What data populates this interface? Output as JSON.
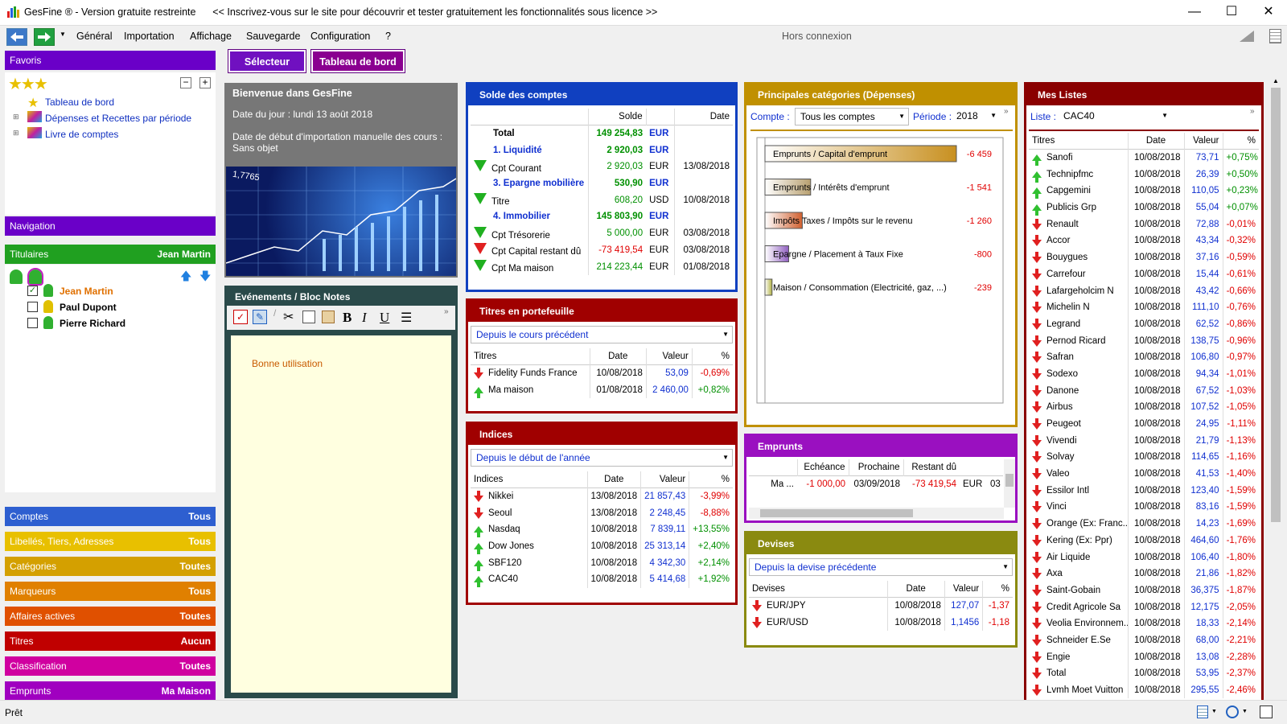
{
  "titlebar": {
    "title": "GesFine ® - Version gratuite restreinte      << Inscrivez-vous sur le site pour découvrir et tester gratuitement les fonctionnalités sous licence >>",
    "minimize": "—",
    "maximize": "☐",
    "close": "✕"
  },
  "menu": {
    "items": [
      "Général",
      "Importation",
      "Affichage",
      "Sauvegarde",
      "Configuration",
      "?"
    ],
    "status": "Hors connexion"
  },
  "tabs": {
    "selector": "Sélecteur",
    "dashboard": "Tableau de bord"
  },
  "left": {
    "favoris": "Favoris",
    "favoris_items": [
      "Tableau de bord",
      "Dépenses et Recettes par période",
      "Livre de comptes"
    ],
    "navigation": "Navigation",
    "titulaires": "Titulaires",
    "titulaires_value": "Jean Martin",
    "people": [
      "Jean Martin",
      "Paul Dupont",
      "Pierre Richard"
    ],
    "sections": [
      {
        "label": "Comptes",
        "value": "Tous",
        "color": "#2e5fd0"
      },
      {
        "label": "Libellés, Tiers, Adresses",
        "value": "Tous",
        "color": "#e8c000"
      },
      {
        "label": "Catégories",
        "value": "Toutes",
        "color": "#d4a000"
      },
      {
        "label": "Marqueurs",
        "value": "Tous",
        "color": "#e08000"
      },
      {
        "label": "Affaires actives",
        "value": "Toutes",
        "color": "#e05000"
      },
      {
        "label": "Titres",
        "value": "Aucun",
        "color": "#c00000"
      },
      {
        "label": "Classification",
        "value": "Toutes",
        "color": "#d000a0"
      },
      {
        "label": "Emprunts",
        "value": "Ma Maison",
        "color": "#a000c0"
      }
    ]
  },
  "welcome": {
    "title": "Bienvenue dans GesFine",
    "date": "Date du jour : lundi 13 août 2018",
    "import": "Date de début d'importation manuelle des cours : Sans objet",
    "img_text": "1,7765"
  },
  "notes": {
    "title": "Evénements / Bloc Notes",
    "text": "Bonne utilisation"
  },
  "solde": {
    "title": "Solde des comptes",
    "headers": [
      "",
      "Solde",
      "",
      "Date"
    ],
    "rows": [
      {
        "label": "Total",
        "amount": "149 254,83",
        "cur": "EUR",
        "date": "",
        "kind": "total",
        "icon": ""
      },
      {
        "label": "1. Liquidité",
        "amount": "2 920,03",
        "cur": "EUR",
        "date": "",
        "kind": "group",
        "icon": ""
      },
      {
        "label": "Cpt Courant",
        "amount": "2 920,03",
        "cur": "EUR",
        "date": "13/08/2018",
        "kind": "item",
        "icon": "g"
      },
      {
        "label": "3. Epargne mobilière",
        "amount": "530,90",
        "cur": "EUR",
        "date": "",
        "kind": "group",
        "icon": ""
      },
      {
        "label": "Titre",
        "amount": "608,20",
        "cur": "USD",
        "date": "10/08/2018",
        "kind": "item",
        "icon": "g"
      },
      {
        "label": "4. Immobilier",
        "amount": "145 803,90",
        "cur": "EUR",
        "date": "",
        "kind": "group",
        "icon": ""
      },
      {
        "label": "Cpt Trésorerie",
        "amount": "5 000,00",
        "cur": "EUR",
        "date": "03/08/2018",
        "kind": "item",
        "icon": "g"
      },
      {
        "label": "Cpt Capital restant dû",
        "amount": "-73 419,54",
        "cur": "EUR",
        "date": "03/08/2018",
        "kind": "neg",
        "icon": "r"
      },
      {
        "label": "Cpt Ma maison",
        "amount": "214 223,44",
        "cur": "EUR",
        "date": "01/08/2018",
        "kind": "item",
        "icon": "g"
      }
    ]
  },
  "portefeuille": {
    "title": "Titres en portefeuille",
    "combo": "Depuis le cours précédent",
    "headers": [
      "Titres",
      "Date",
      "Valeur",
      "%"
    ],
    "rows": [
      {
        "name": "Fidelity Funds France",
        "date": "10/08/2018",
        "value": "53,09",
        "pct": "-0,69%",
        "dir": "dn"
      },
      {
        "name": "Ma maison",
        "date": "01/08/2018",
        "value": "2 460,00",
        "pct": "+0,82%",
        "dir": "up"
      }
    ]
  },
  "indices": {
    "title": "Indices",
    "combo": "Depuis le début de l'année",
    "headers": [
      "Indices",
      "Date",
      "Valeur",
      "%"
    ],
    "rows": [
      {
        "name": "Nikkei",
        "date": "13/08/2018",
        "value": "21 857,43",
        "pct": "-3,99%",
        "dir": "dn"
      },
      {
        "name": "Seoul",
        "date": "13/08/2018",
        "value": "2 248,45",
        "pct": "-8,88%",
        "dir": "dn"
      },
      {
        "name": "Nasdaq",
        "date": "10/08/2018",
        "value": "7 839,11",
        "pct": "+13,55%",
        "dir": "up"
      },
      {
        "name": "Dow Jones",
        "date": "10/08/2018",
        "value": "25 313,14",
        "pct": "+2,40%",
        "dir": "up"
      },
      {
        "name": "SBF120",
        "date": "10/08/2018",
        "value": "4 342,30",
        "pct": "+2,14%",
        "dir": "up"
      },
      {
        "name": "CAC40",
        "date": "10/08/2018",
        "value": "5 414,68",
        "pct": "+1,92%",
        "dir": "up"
      }
    ]
  },
  "categories": {
    "title": "Principales catégories (Dépenses)",
    "compte_label": "Compte :",
    "compte_value": "Tous les comptes",
    "periode_label": "Période :",
    "periode_value": "2018",
    "bars": [
      {
        "cat": "Emprunts",
        "sub": " / Capital d'emprunt",
        "value": "-6 459",
        "amount": 6459,
        "color": "#c89020"
      },
      {
        "cat": "Emprunts",
        "sub": " / Intérêts d'emprunt",
        "value": "-1 541",
        "amount": 1541,
        "color": "#b8a070"
      },
      {
        "cat": "Impôts",
        "sub": " Taxes / Impôts sur le revenu",
        "value": "-1 260",
        "amount": 1260,
        "color": "#d06030"
      },
      {
        "cat": "Epargne",
        "sub": " / Placement à Taux Fixe",
        "value": "-800",
        "amount": 800,
        "color": "#9060c0"
      },
      {
        "cat": "",
        "sub": "Maison / Consommation (Electricité, gaz, ...)",
        "value": "-239",
        "amount": 239,
        "color": "#b0b040"
      }
    ]
  },
  "emprunts": {
    "title": "Emprunts",
    "headers": [
      "",
      "Echéance",
      "Prochaine",
      "Restant dû",
      "",
      ""
    ],
    "row": [
      "Ma ...",
      "-1 000,00",
      "03/09/2018",
      "-73 419,54",
      "EUR",
      "03"
    ]
  },
  "devises": {
    "title": "Devises",
    "combo": "Depuis la devise précédente",
    "headers": [
      "Devises",
      "Date",
      "Valeur",
      "%"
    ],
    "rows": [
      {
        "name": "EUR/JPY",
        "date": "10/08/2018",
        "value": "127,07",
        "pct": "-1,37"
      },
      {
        "name": "EUR/USD",
        "date": "10/08/2018",
        "value": "1,1456",
        "pct": "-1,18"
      }
    ]
  },
  "listes": {
    "title": "Mes Listes",
    "liste_label": "Liste :",
    "liste_value": "CAC40",
    "headers": [
      "Titres",
      "Date",
      "Valeur",
      "%"
    ],
    "rows": [
      {
        "name": "Sanofi",
        "date": "10/08/2018",
        "value": "73,71",
        "pct": "+0,75%",
        "dir": "up"
      },
      {
        "name": "Technipfmc",
        "date": "10/08/2018",
        "value": "26,39",
        "pct": "+0,50%",
        "dir": "up"
      },
      {
        "name": "Capgemini",
        "date": "10/08/2018",
        "value": "110,05",
        "pct": "+0,23%",
        "dir": "up"
      },
      {
        "name": "Publicis Grp",
        "date": "10/08/2018",
        "value": "55,04",
        "pct": "+0,07%",
        "dir": "up"
      },
      {
        "name": "Renault",
        "date": "10/08/2018",
        "value": "72,88",
        "pct": "-0,01%",
        "dir": "dn"
      },
      {
        "name": "Accor",
        "date": "10/08/2018",
        "value": "43,34",
        "pct": "-0,32%",
        "dir": "dn"
      },
      {
        "name": "Bouygues",
        "date": "10/08/2018",
        "value": "37,16",
        "pct": "-0,59%",
        "dir": "dn"
      },
      {
        "name": "Carrefour",
        "date": "10/08/2018",
        "value": "15,44",
        "pct": "-0,61%",
        "dir": "dn"
      },
      {
        "name": "Lafargeholcim N",
        "date": "10/08/2018",
        "value": "43,42",
        "pct": "-0,66%",
        "dir": "dn"
      },
      {
        "name": "Michelin N",
        "date": "10/08/2018",
        "value": "111,10",
        "pct": "-0,76%",
        "dir": "dn"
      },
      {
        "name": "Legrand",
        "date": "10/08/2018",
        "value": "62,52",
        "pct": "-0,86%",
        "dir": "dn"
      },
      {
        "name": "Pernod Ricard",
        "date": "10/08/2018",
        "value": "138,75",
        "pct": "-0,96%",
        "dir": "dn"
      },
      {
        "name": "Safran",
        "date": "10/08/2018",
        "value": "106,80",
        "pct": "-0,97%",
        "dir": "dn"
      },
      {
        "name": "Sodexo",
        "date": "10/08/2018",
        "value": "94,34",
        "pct": "-1,01%",
        "dir": "dn"
      },
      {
        "name": "Danone",
        "date": "10/08/2018",
        "value": "67,52",
        "pct": "-1,03%",
        "dir": "dn"
      },
      {
        "name": "Airbus",
        "date": "10/08/2018",
        "value": "107,52",
        "pct": "-1,05%",
        "dir": "dn"
      },
      {
        "name": "Peugeot",
        "date": "10/08/2018",
        "value": "24,95",
        "pct": "-1,11%",
        "dir": "dn"
      },
      {
        "name": "Vivendi",
        "date": "10/08/2018",
        "value": "21,79",
        "pct": "-1,13%",
        "dir": "dn"
      },
      {
        "name": "Solvay",
        "date": "10/08/2018",
        "value": "114,65",
        "pct": "-1,16%",
        "dir": "dn"
      },
      {
        "name": "Valeo",
        "date": "10/08/2018",
        "value": "41,53",
        "pct": "-1,40%",
        "dir": "dn"
      },
      {
        "name": "Essilor Intl",
        "date": "10/08/2018",
        "value": "123,40",
        "pct": "-1,59%",
        "dir": "dn"
      },
      {
        "name": "Vinci",
        "date": "10/08/2018",
        "value": "83,16",
        "pct": "-1,59%",
        "dir": "dn"
      },
      {
        "name": "Orange (Ex: Franc...",
        "date": "10/08/2018",
        "value": "14,23",
        "pct": "-1,69%",
        "dir": "dn"
      },
      {
        "name": "Kering (Ex: Ppr)",
        "date": "10/08/2018",
        "value": "464,60",
        "pct": "-1,76%",
        "dir": "dn"
      },
      {
        "name": "Air Liquide",
        "date": "10/08/2018",
        "value": "106,40",
        "pct": "-1,80%",
        "dir": "dn"
      },
      {
        "name": "Axa",
        "date": "10/08/2018",
        "value": "21,86",
        "pct": "-1,82%",
        "dir": "dn"
      },
      {
        "name": "Saint-Gobain",
        "date": "10/08/2018",
        "value": "36,375",
        "pct": "-1,87%",
        "dir": "dn"
      },
      {
        "name": "Credit Agricole Sa",
        "date": "10/08/2018",
        "value": "12,175",
        "pct": "-2,05%",
        "dir": "dn"
      },
      {
        "name": "Veolia Environnem...",
        "date": "10/08/2018",
        "value": "18,33",
        "pct": "-2,14%",
        "dir": "dn"
      },
      {
        "name": "Schneider E.Se",
        "date": "10/08/2018",
        "value": "68,00",
        "pct": "-2,21%",
        "dir": "dn"
      },
      {
        "name": "Engie",
        "date": "10/08/2018",
        "value": "13,08",
        "pct": "-2,28%",
        "dir": "dn"
      },
      {
        "name": "Total",
        "date": "10/08/2018",
        "value": "53,95",
        "pct": "-2,37%",
        "dir": "dn"
      },
      {
        "name": "Lvmh Moet Vuitton",
        "date": "10/08/2018",
        "value": "295,55",
        "pct": "-2,46%",
        "dir": "dn"
      }
    ]
  },
  "status": {
    "text": "Prêt"
  },
  "colors": {
    "purple": "#6a00c8",
    "blue": "#1040c0",
    "red": "#a00000",
    "gold": "#c09000",
    "magenta": "#9a10c0",
    "olive": "#8a8a10",
    "darkred": "#8a0000"
  }
}
